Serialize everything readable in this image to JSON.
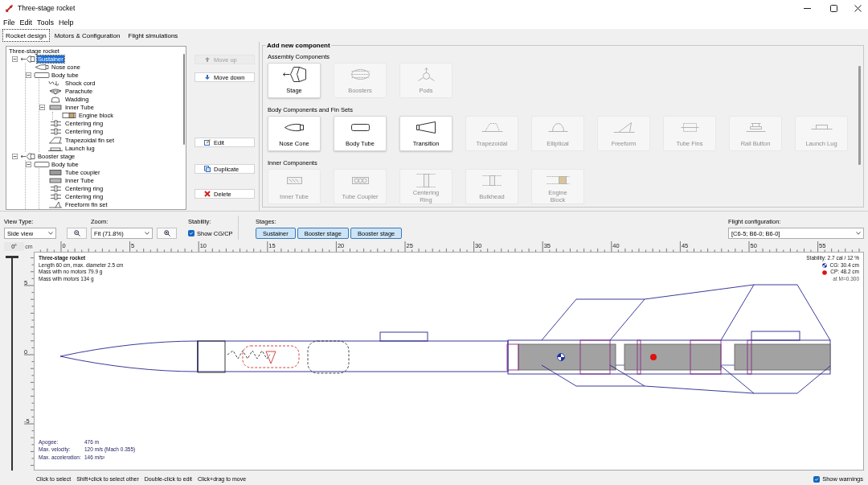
{
  "window": {
    "title": "Three-stage rocket"
  },
  "menu": [
    "File",
    "Edit",
    "Tools",
    "Help"
  ],
  "tabs": [
    {
      "label": "Rocket design",
      "selected": true
    },
    {
      "label": "Motors & Configuration",
      "selected": false
    },
    {
      "label": "Flight simulations",
      "selected": false
    }
  ],
  "tree": {
    "root": "Three-stage rocket",
    "items": [
      {
        "label": "Sustainer",
        "kind": "stage",
        "selected": true,
        "expanded": true,
        "children": [
          {
            "label": "Nose cone",
            "kind": "nose_cone",
            "selected": false
          },
          {
            "label": "Body tube",
            "kind": "body_tube",
            "selected": false,
            "expanded": true,
            "children": [
              {
                "label": "Shock cord",
                "kind": "shock_cord",
                "selected": false
              },
              {
                "label": "Parachute",
                "kind": "parachute",
                "selected": false
              },
              {
                "label": "Wadding",
                "kind": "wadding",
                "selected": false
              },
              {
                "label": "Inner Tube",
                "kind": "inner_tube",
                "selected": false,
                "expanded": true,
                "children": [
                  {
                    "label": "Engine block",
                    "kind": "engine_block",
                    "selected": false
                  }
                ]
              },
              {
                "label": "Centering ring",
                "kind": "centering_ring",
                "selected": false
              },
              {
                "label": "Centering ring",
                "kind": "centering_ring",
                "selected": false
              },
              {
                "label": "Trapezoidal fin set",
                "kind": "trapezoidal_fins",
                "selected": false
              },
              {
                "label": "Launch lug",
                "kind": "launch_lug",
                "selected": false
              }
            ]
          }
        ]
      },
      {
        "label": "Booster stage",
        "kind": "stage",
        "selected": false,
        "expanded": true,
        "children": [
          {
            "label": "Body tube",
            "kind": "body_tube",
            "selected": false,
            "expanded": true,
            "children": [
              {
                "label": "Tube coupler",
                "kind": "tube_coupler",
                "selected": false
              },
              {
                "label": "Inner Tube",
                "kind": "inner_tube",
                "selected": false
              },
              {
                "label": "Centering ring",
                "kind": "centering_ring",
                "selected": false
              },
              {
                "label": "Centering ring",
                "kind": "centering_ring",
                "selected": false
              },
              {
                "label": "Freeform fin set",
                "kind": "freeform_fins",
                "selected": false
              }
            ]
          }
        ]
      }
    ]
  },
  "actions": [
    {
      "label": "Move up",
      "kind": "up",
      "disabled": true
    },
    {
      "label": "Move down",
      "kind": "down",
      "disabled": false
    },
    {
      "label": "Edit",
      "kind": "edit",
      "disabled": false
    },
    {
      "label": "Duplicate",
      "kind": "duplicate",
      "disabled": false
    },
    {
      "label": "Delete",
      "kind": "delete",
      "disabled": false
    }
  ],
  "component_panel": {
    "title": "Add new component",
    "sections": [
      {
        "title": "Assembly Components",
        "items": [
          {
            "label": "Stage",
            "kind": "stage",
            "disabled": false
          },
          {
            "label": "Boosters",
            "kind": "boosters",
            "disabled": true
          },
          {
            "label": "Pods",
            "kind": "pods",
            "disabled": true
          }
        ]
      },
      {
        "title": "Body Components and Fin Sets",
        "items": [
          {
            "label": "Nose Cone",
            "kind": "nose_cone",
            "disabled": false
          },
          {
            "label": "Body Tube",
            "kind": "body_tube",
            "disabled": false
          },
          {
            "label": "Transition",
            "kind": "transition",
            "disabled": false
          },
          {
            "label": "Trapezoidal",
            "kind": "trapezoidal",
            "disabled": true
          },
          {
            "label": "Elliptical",
            "kind": "elliptical",
            "disabled": true
          },
          {
            "label": "Freeform",
            "kind": "freeform",
            "disabled": true
          },
          {
            "label": "Tube Fins",
            "kind": "tube_fins",
            "disabled": true
          },
          {
            "label": "Rail Button",
            "kind": "rail_button",
            "disabled": true
          },
          {
            "label": "Launch Lug",
            "kind": "launch_lug",
            "disabled": true
          }
        ]
      },
      {
        "title": "Inner Components",
        "items": [
          {
            "label": "Inner Tube",
            "kind": "inner_tube",
            "disabled": true
          },
          {
            "label": "Tube Coupler",
            "kind": "tube_coupler",
            "disabled": true
          },
          {
            "label": "Centering\nRing",
            "kind": "centering_ring",
            "disabled": true
          },
          {
            "label": "Bulkhead",
            "kind": "bulkhead",
            "disabled": true
          },
          {
            "label": "Engine\nBlock",
            "kind": "engine_block",
            "disabled": true
          }
        ]
      }
    ]
  },
  "view_controls": {
    "view_type_label": "View Type:",
    "view_type": "Side view",
    "zoom_label": "Zoom:",
    "zoom": "Fit (71.8%)",
    "stability_label": "Stability:",
    "show_cg_cp": {
      "label": "Show CG/CP",
      "checked": true
    },
    "stages_label": "Stages:",
    "stages": [
      {
        "label": "Sustainer",
        "selected": true
      },
      {
        "label": "Booster stage",
        "selected": true
      },
      {
        "label": "Booster stage",
        "selected": true
      }
    ],
    "flight_config_label": "Flight configuration:",
    "flight_config": "[C6-5; B6-0; B6-0]"
  },
  "rotation": {
    "value": "0°",
    "level": 0
  },
  "ruler": {
    "unit": "cm",
    "x_labels": [
      "0",
      "5",
      "10",
      "15",
      "20",
      "25",
      "30",
      "35",
      "40",
      "45",
      "50",
      "55"
    ],
    "y_labels": [
      "5",
      "0",
      "-5"
    ]
  },
  "rocket_info": {
    "name": "Three-stage rocket",
    "lines": [
      "Length 60 cm, max. diameter 2.5 cm",
      "Mass with no motors 79.9 g",
      "Mass with motors 134 g"
    ]
  },
  "stability_info": {
    "stability": "Stability: 2.7 cal / 12 %",
    "cg": "CG: 30.4 cm",
    "cp": "CP: 48.2 cm",
    "mach": "at M=0.300"
  },
  "flight_info": [
    {
      "label": "Apogee:",
      "value": "476 m"
    },
    {
      "label": "Max. velocity:",
      "value": "120 m/s (Mach 0.355)"
    },
    {
      "label": "Max. acceleration:",
      "value": "146 m/s²"
    }
  ],
  "status_bar": {
    "hints": [
      "Click to select",
      "Shift+click to select other",
      "Double-click to edit",
      "Click+drag to move"
    ],
    "show_warnings": {
      "label": "Show warnings",
      "checked": true
    }
  }
}
